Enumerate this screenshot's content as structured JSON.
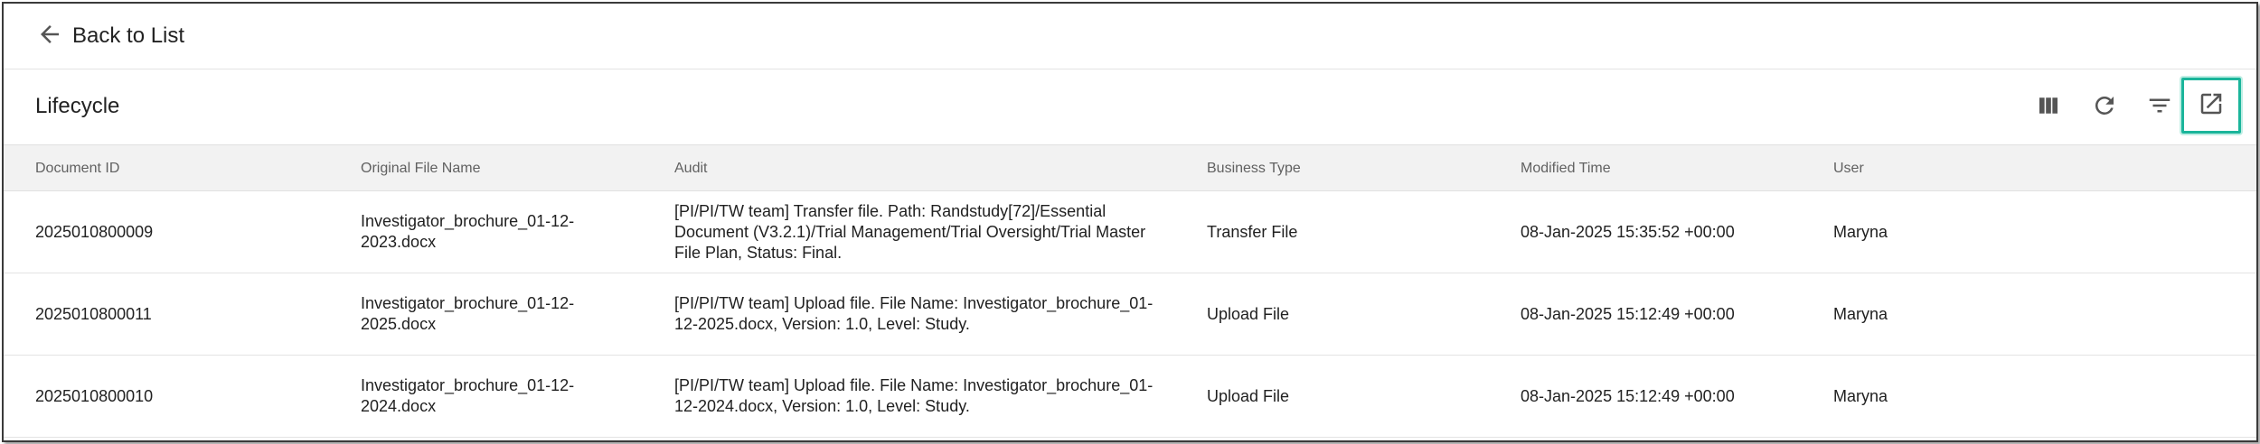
{
  "nav": {
    "back_label": "Back to List",
    "back_icon": "arrow-left-icon"
  },
  "toolbar": {
    "title": "Lifecycle",
    "icons": [
      "columns-icon",
      "refresh-icon",
      "filter-icon",
      "open-external-icon"
    ],
    "highlight_color": "#1bb59b"
  },
  "table": {
    "headers": [
      "Document ID",
      "Original File Name",
      "Audit",
      "Business Type",
      "Modified Time",
      "User"
    ],
    "rows": [
      {
        "document_id": "2025010800009",
        "file_name": "Investigator_brochure_01-12-2023.docx",
        "audit": "[PI/PI/TW team] Transfer file. Path: Randstudy[72]/Essential Document (V3.2.1)/Trial Management/Trial Oversight/Trial Master File Plan, Status: Final.",
        "business_type": "Transfer File",
        "modified_time": "08-Jan-2025 15:35:52 +00:00",
        "user": "Maryna"
      },
      {
        "document_id": "2025010800011",
        "file_name": "Investigator_brochure_01-12-2025.docx",
        "audit": "[PI/PI/TW team] Upload file. File Name: Investigator_brochure_01-12-2025.docx, Version: 1.0, Level: Study.",
        "business_type": "Upload File",
        "modified_time": "08-Jan-2025 15:12:49 +00:00",
        "user": "Maryna"
      },
      {
        "document_id": "2025010800010",
        "file_name": "Investigator_brochure_01-12-2024.docx",
        "audit": "[PI/PI/TW team] Upload file. File Name: Investigator_brochure_01-12-2024.docx, Version: 1.0, Level: Study.",
        "business_type": "Upload File",
        "modified_time": "08-Jan-2025 15:12:49 +00:00",
        "user": "Maryna"
      }
    ]
  }
}
